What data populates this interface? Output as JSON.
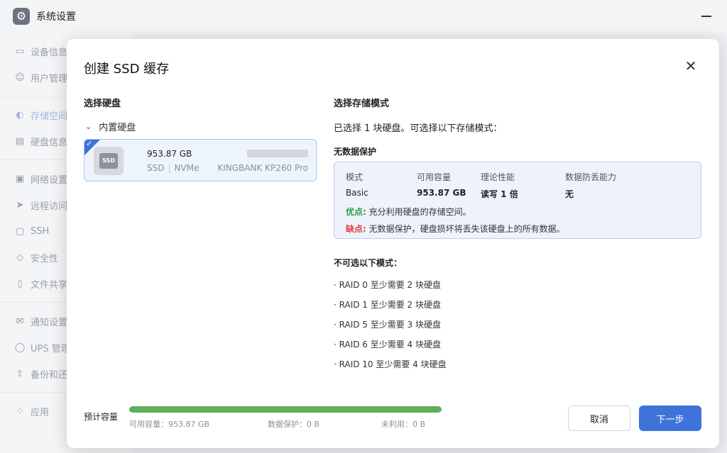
{
  "window": {
    "title": "系统设置",
    "icon": "gear-icon"
  },
  "sidebar": {
    "items": [
      {
        "label": "设备信息",
        "icon": "device-icon"
      },
      {
        "label": "用户管理",
        "icon": "user-icon"
      },
      {
        "label": "存储空间",
        "icon": "storage-icon"
      },
      {
        "label": "硬盘信息",
        "icon": "disk-icon"
      },
      {
        "label": "网络设置",
        "icon": "network-icon"
      },
      {
        "label": "远程访问",
        "icon": "remote-icon"
      },
      {
        "label": "SSH",
        "icon": "ssh-icon"
      },
      {
        "label": "安全性",
        "icon": "shield-icon"
      },
      {
        "label": "文件共享",
        "icon": "file-icon"
      },
      {
        "label": "通知设置",
        "icon": "mail-icon"
      },
      {
        "label": "UPS 管理",
        "icon": "ups-icon"
      },
      {
        "label": "备份和还原",
        "icon": "backup-icon"
      },
      {
        "label": "应用",
        "icon": "apps-icon"
      }
    ]
  },
  "modal": {
    "title": "创建 SSD 缓存",
    "close_icon": "close-icon",
    "left": {
      "section_title": "选择硬盘",
      "group_label": "内置硬盘",
      "disk": {
        "size": "953.87 GB",
        "type": "SSD",
        "interface": "NVMe",
        "model": "KINGBANK KP260 Pro",
        "badge": "SSD"
      }
    },
    "right": {
      "section_title": "选择存储模式",
      "summary": "已选择 1 块硬盘。可选择以下存储模式：",
      "mode_group_title": "无数据保护",
      "mode_table": {
        "headers": [
          "模式",
          "可用容量",
          "理论性能",
          "数据防丢能力"
        ],
        "values": [
          "Basic",
          "953.87 GB",
          "读写 1 倍",
          "无"
        ]
      },
      "pros_key": "优点:",
      "pros_text": "充分利用硬盘的存储空间。",
      "cons_key": "缺点:",
      "cons_text": "无数据保护，硬盘损坏将丢失该硬盘上的所有数据。",
      "unavailable_title": "不可选以下模式：",
      "unavailable": [
        "· RAID 0   至少需要 2 块硬盘",
        "· RAID 1   至少需要 2 块硬盘",
        "· RAID 5   至少需要 3 块硬盘",
        "· RAID 6   至少需要 4 块硬盘",
        "· RAID 10   至少需要 4 块硬盘"
      ]
    },
    "footer": {
      "estimate_label": "预计容量",
      "usage_fraction": 1.0,
      "usable_label": "可用容量：953.87 GB",
      "protect_label": "数据保护：0 B",
      "unused_label": "未利用：0 B",
      "cancel_label": "取消",
      "next_label": "下一步"
    }
  },
  "colors": {
    "accent": "#3f73d9",
    "success": "#5fae5b",
    "danger": "#e04040"
  }
}
